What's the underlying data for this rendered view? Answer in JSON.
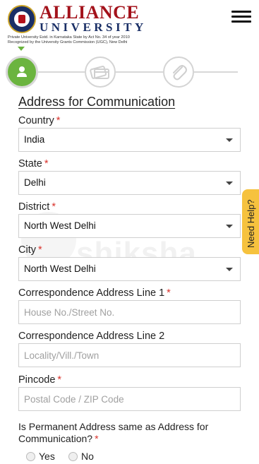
{
  "header": {
    "brand_name": "ALLIANCE",
    "brand_sub": "UNIVERSITY",
    "fine_print_1": "Private University Estd. in Karnataka State by Act No. 34 of year 2010",
    "fine_print_2": "Recognized by the University Grants Commission (UGC), New Delhi",
    "menu_icon": "hamburger-menu-icon"
  },
  "steps": [
    {
      "icon": "user-icon",
      "state": "active"
    },
    {
      "icon": "payment-cards-icon",
      "state": "inactive"
    },
    {
      "icon": "paperclip-icon",
      "state": "inactive"
    }
  ],
  "form": {
    "section_title": "Address for Communication",
    "required_mark": "*",
    "country": {
      "label": "Country",
      "value": "India"
    },
    "state": {
      "label": "State",
      "value": "Delhi"
    },
    "district": {
      "label": "District",
      "value": "North West Delhi"
    },
    "city": {
      "label": "City",
      "value": "North West Delhi"
    },
    "address_line_1": {
      "label": "Correspondence Address Line 1",
      "placeholder": "House No./Street No."
    },
    "address_line_2": {
      "label": "Correspondence Address Line 2",
      "placeholder": "Locality/Vill./Town"
    },
    "pincode": {
      "label": "Pincode",
      "placeholder": "Postal Code / ZIP Code"
    },
    "permanent_question": "Is Permanent Address same as Address for Communication?",
    "options": {
      "yes": "Yes",
      "no": "No"
    }
  },
  "help_tab": {
    "label": "Need Help?",
    "color": "#f6c23e"
  },
  "watermark": "shiksha",
  "colors": {
    "brand_red": "#a3121b",
    "brand_blue": "#1a2f66",
    "step_active": "#6bb43f",
    "required": "#d9322b"
  }
}
